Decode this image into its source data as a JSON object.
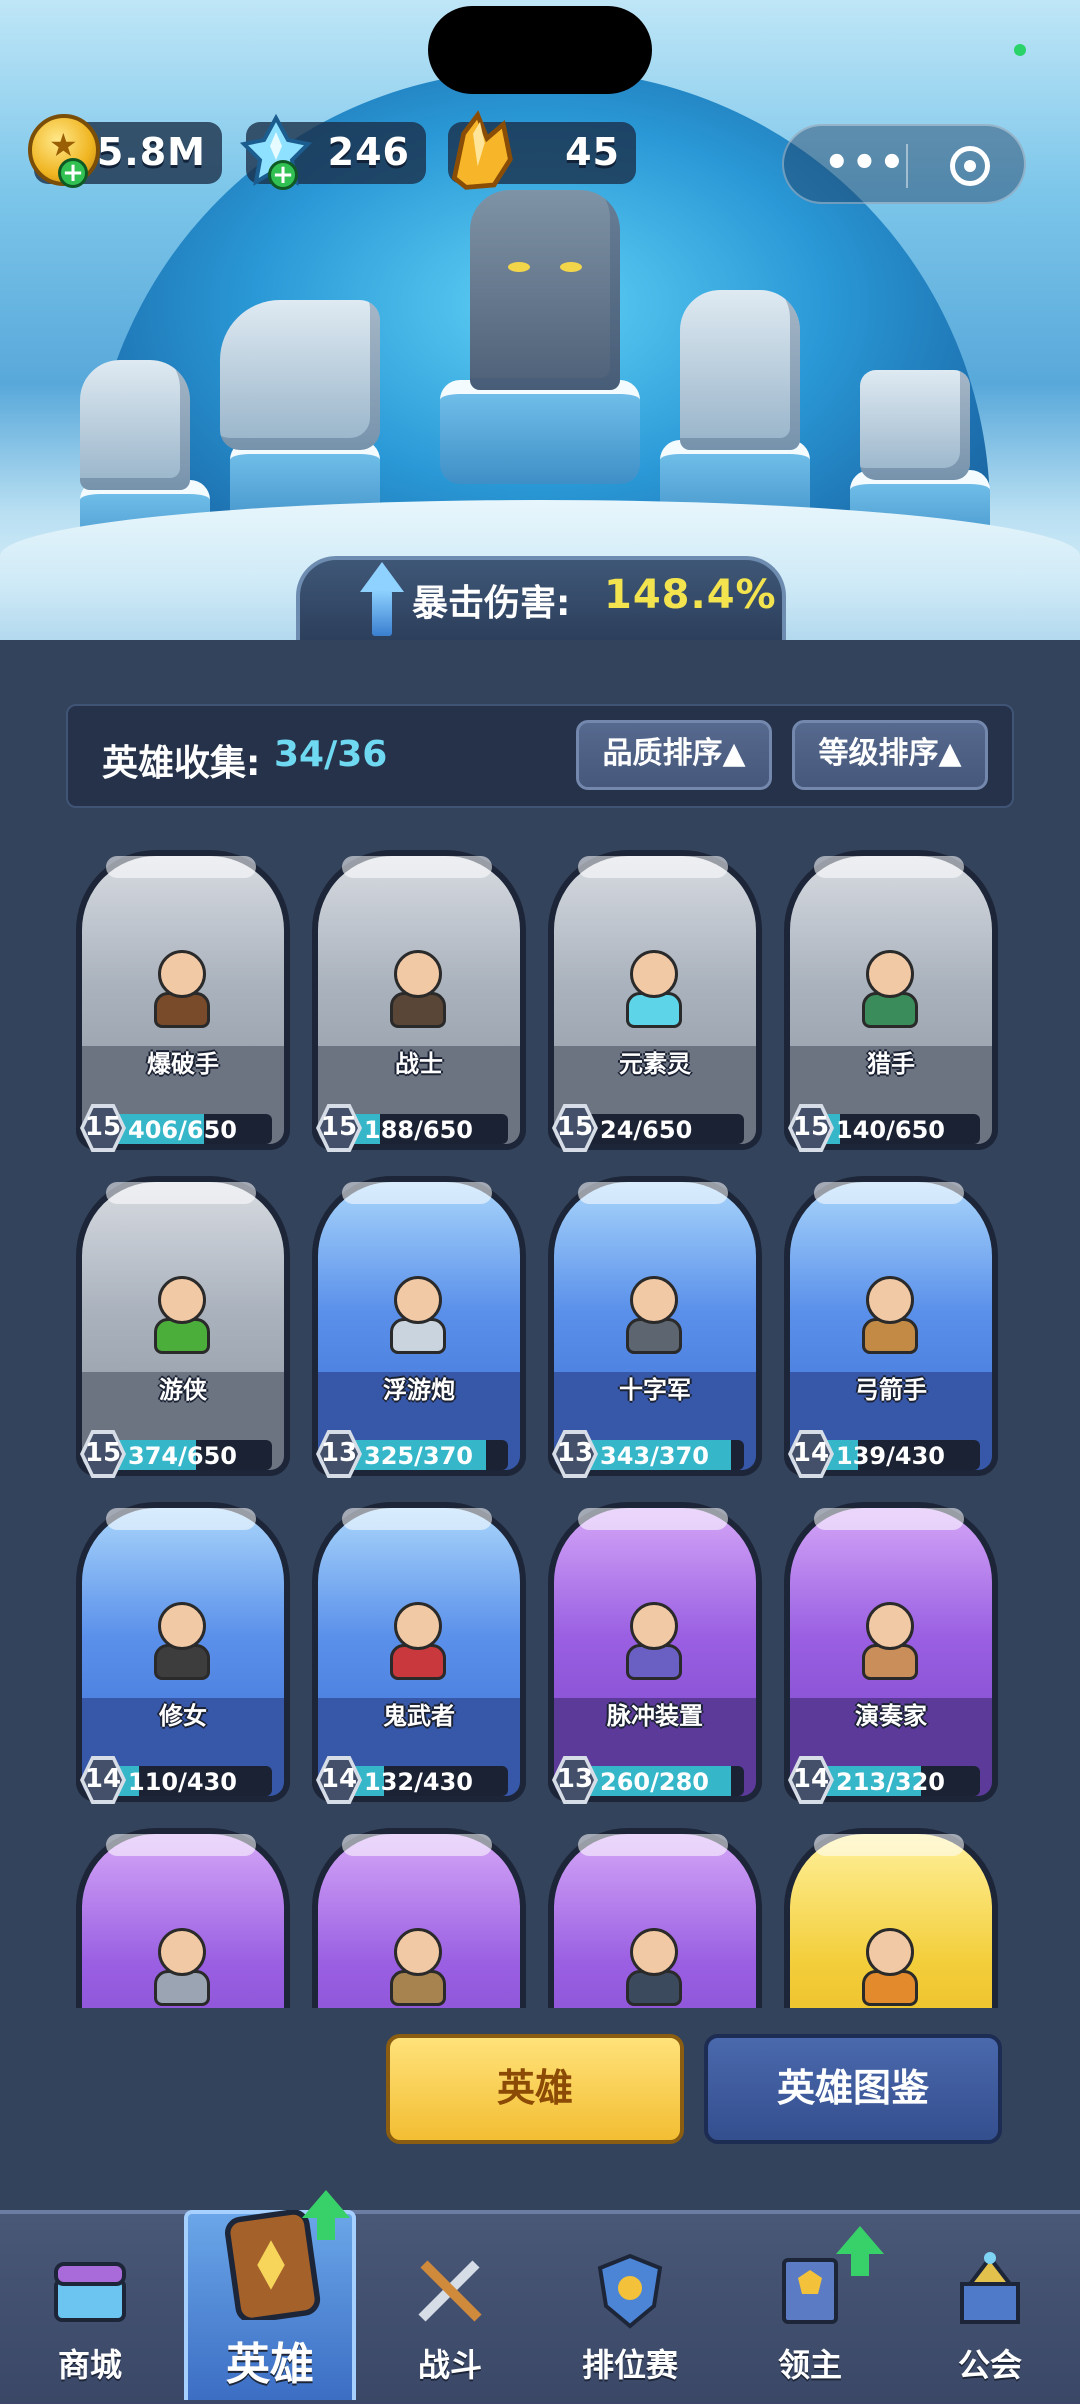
{
  "currency": {
    "coins": "5.8M",
    "diamonds": "246",
    "crystals": "45"
  },
  "crit": {
    "label": "暴击伤害:",
    "value": "148.4%"
  },
  "collection": {
    "label": "英雄收集:",
    "value": "34/36",
    "sort_quality": "品质排序▲",
    "sort_level": "等级排序▲"
  },
  "heroes": [
    {
      "name": "爆破手",
      "level": "15",
      "progress": "406/650",
      "fill": 0.62,
      "rarity": "gray"
    },
    {
      "name": "战士",
      "level": "15",
      "progress": "188/650",
      "fill": 0.29,
      "rarity": "gray"
    },
    {
      "name": "元素灵",
      "level": "15",
      "progress": "24/650",
      "fill": 0.04,
      "rarity": "gray"
    },
    {
      "name": "猎手",
      "level": "15",
      "progress": "140/650",
      "fill": 0.22,
      "rarity": "gray"
    },
    {
      "name": "游侠",
      "level": "15",
      "progress": "374/650",
      "fill": 0.58,
      "rarity": "gray"
    },
    {
      "name": "浮游炮",
      "level": "13",
      "progress": "325/370",
      "fill": 0.88,
      "rarity": "blue"
    },
    {
      "name": "十字军",
      "level": "13",
      "progress": "343/370",
      "fill": 0.93,
      "rarity": "blue"
    },
    {
      "name": "弓箭手",
      "level": "14",
      "progress": "139/430",
      "fill": 0.32,
      "rarity": "blue"
    },
    {
      "name": "修女",
      "level": "14",
      "progress": "110/430",
      "fill": 0.26,
      "rarity": "blue"
    },
    {
      "name": "鬼武者",
      "level": "14",
      "progress": "132/430",
      "fill": 0.31,
      "rarity": "blue"
    },
    {
      "name": "脉冲装置",
      "level": "13",
      "progress": "260/280",
      "fill": 0.93,
      "rarity": "purple"
    },
    {
      "name": "演奏家",
      "level": "14",
      "progress": "213/320",
      "fill": 0.67,
      "rarity": "purple"
    },
    {
      "name": "",
      "level": "",
      "progress": "",
      "fill": 0,
      "rarity": "purple"
    },
    {
      "name": "",
      "level": "",
      "progress": "",
      "fill": 0,
      "rarity": "purple"
    },
    {
      "name": "",
      "level": "",
      "progress": "",
      "fill": 0,
      "rarity": "purple"
    },
    {
      "name": "",
      "level": "",
      "progress": "",
      "fill": 0,
      "rarity": "gold"
    }
  ],
  "buttons": {
    "hero": "英雄",
    "codex": "英雄图鉴"
  },
  "nav": [
    {
      "label": "商城",
      "icon": "shop-chest-icon"
    },
    {
      "label": "英雄",
      "icon": "hero-card-icon",
      "active": true
    },
    {
      "label": "战斗",
      "icon": "crossed-swords-icon"
    },
    {
      "label": "排位赛",
      "icon": "rank-shield-icon"
    },
    {
      "label": "领主",
      "icon": "lord-banner-icon"
    },
    {
      "label": "公会",
      "icon": "guild-castle-icon"
    }
  ],
  "colors": {
    "accent_cyan": "#6fd9f2",
    "crit_yellow": "#f3e34e",
    "progress_fill": "#36b7c9",
    "gold_button": "#f3be33",
    "blue_button": "#344f8e"
  }
}
